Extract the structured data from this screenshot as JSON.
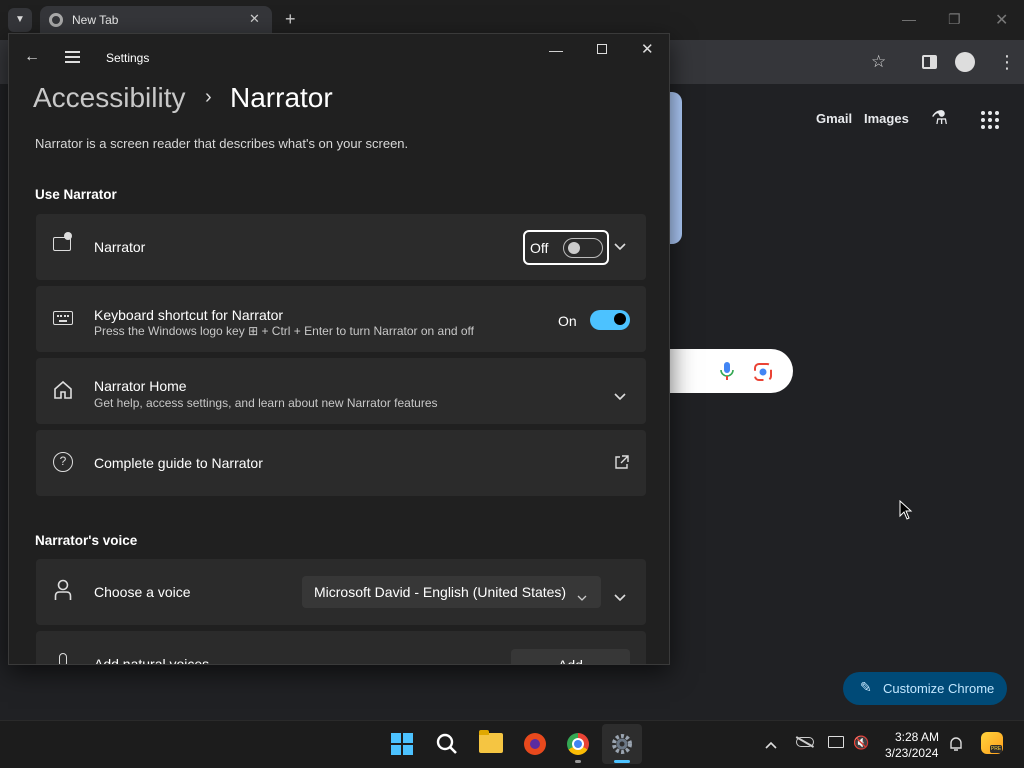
{
  "chrome": {
    "tab_title": "New Tab",
    "links": {
      "gmail": "Gmail",
      "images": "Images"
    },
    "customize_label": "Customize Chrome"
  },
  "settings": {
    "window_title": "Settings",
    "breadcrumb_parent": "Accessibility",
    "breadcrumb_sep": "›",
    "page_title": "Narrator",
    "description": "Narrator is a screen reader that describes what's on your screen.",
    "section_use": "Use Narrator",
    "narrator": {
      "label": "Narrator",
      "state": "Off"
    },
    "keyboard": {
      "label": "Keyboard shortcut for Narrator",
      "sub": "Press the Windows logo key ⊞ + Ctrl + Enter to turn Narrator on and off",
      "state": "On"
    },
    "home": {
      "label": "Narrator Home",
      "sub": "Get help, access settings, and learn about new Narrator features"
    },
    "guide": {
      "label": "Complete guide to Narrator"
    },
    "section_voice": "Narrator's voice",
    "voice": {
      "label": "Choose a voice",
      "value": "Microsoft David - English (United States)"
    },
    "natural": {
      "label": "Add natural voices",
      "button": "Add"
    }
  },
  "taskbar": {
    "time": "3:28 AM",
    "date": "3/23/2024",
    "apps": [
      "start-icon",
      "search-icon",
      "file-explorer-icon",
      "firefox-icon",
      "chrome-icon",
      "settings-icon"
    ]
  },
  "colors": {
    "accent": "#4cc2ff",
    "chrome_button": "#1a73e8"
  }
}
